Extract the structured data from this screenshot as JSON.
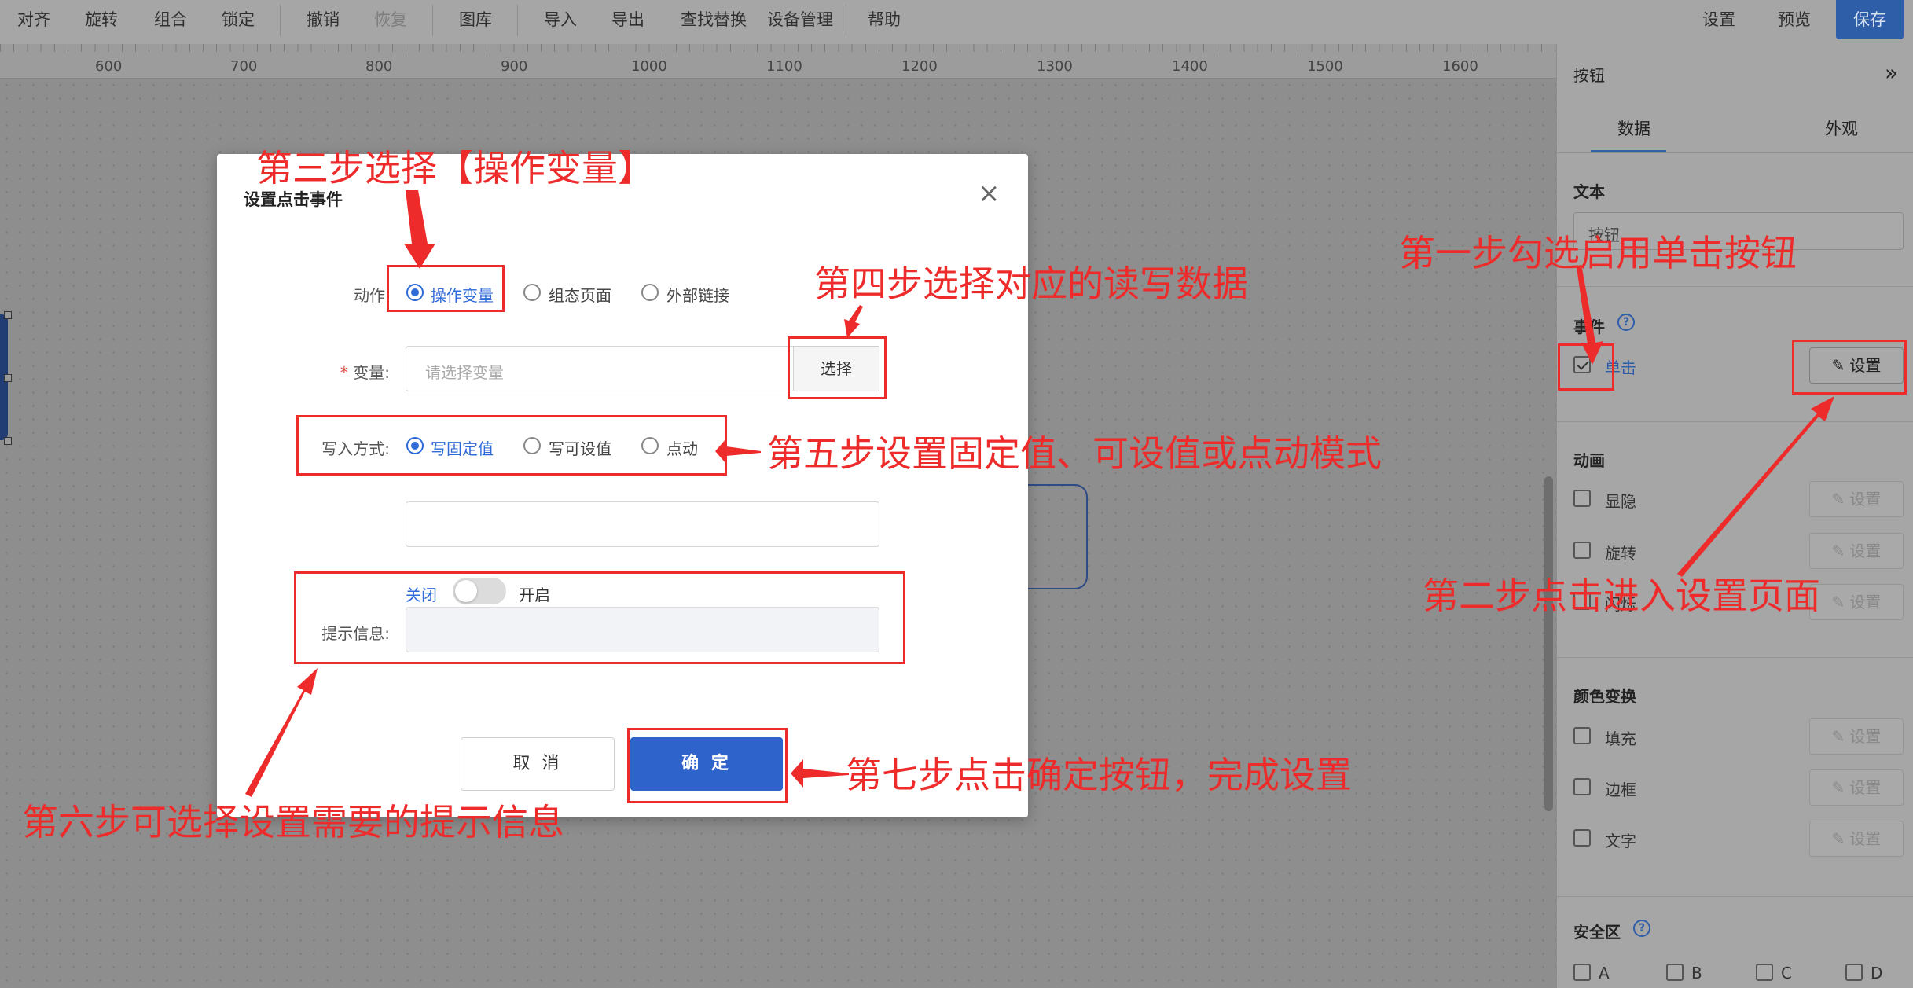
{
  "toolbar": {
    "items": [
      "对齐",
      "旋转",
      "组合",
      "锁定",
      "撤销",
      "恢复",
      "图库",
      "导入",
      "导出",
      "查找替换",
      "设备管理",
      "帮助"
    ],
    "settings": "设置",
    "preview": "预览",
    "save": "保存"
  },
  "ruler": {
    "labels": [
      "600",
      "700",
      "800",
      "900",
      "1000",
      "1100",
      "1200",
      "1300",
      "1400",
      "1500",
      "1600"
    ]
  },
  "panel": {
    "title": "按钮",
    "tabs": [
      "数据",
      "外观"
    ],
    "text_section": "文本",
    "text_value": "按钮",
    "event_section": "事件",
    "event_click": "单击",
    "set_label": "设置",
    "animation_section": "动画",
    "animation_items": [
      "显隐",
      "旋转",
      "闪烁"
    ],
    "color_section": "颜色变换",
    "color_items": [
      "填充",
      "边框",
      "文字"
    ],
    "safe_section": "安全区",
    "safe_items": [
      "A",
      "B",
      "C",
      "D"
    ]
  },
  "dialog": {
    "title": "设置点击事件",
    "action_label": "动作",
    "action_options": [
      "操作变量",
      "组态页面",
      "外部链接"
    ],
    "variable_label": "变量:",
    "variable_placeholder": "请选择变量",
    "choose_button": "选择",
    "write_label": "写入方式:",
    "write_options": [
      "写固定值",
      "写可设值",
      "点动"
    ],
    "tip_label": "提示信息:",
    "toggle_off": "关闭",
    "toggle_on": "开启",
    "cancel": "取 消",
    "confirm": "确 定"
  },
  "annotations": {
    "step1": "第一步勾选启用单击按钮",
    "step2": "第二步点击进入设置页面",
    "step3": "第三步选择【操作变量】",
    "step4": "第四步选择对应的读写数据",
    "step5": "第五步设置固定值、可设值或点动模式",
    "step6": "第六步可选择设置需要的提示信息",
    "step7": "第七步点击确定按钮，完成设置"
  },
  "colors": {
    "annotation": "#ee2b2b",
    "primary": "#2f63cc",
    "save": "#2f5ea8"
  }
}
